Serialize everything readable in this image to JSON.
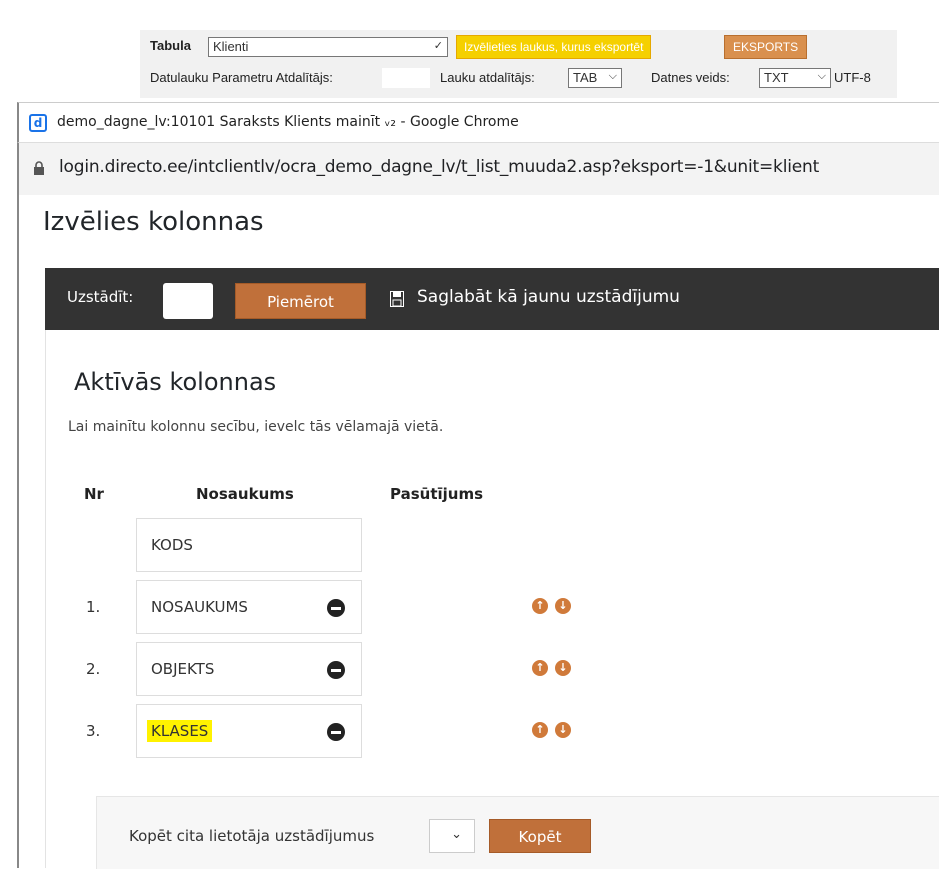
{
  "toolbar": {
    "tabula_label": "Tabula",
    "tabula_value": "Klienti",
    "choose_fields_button": "Izvēlieties laukus, kurus eksportēt",
    "export_button": "EKSPORTS",
    "date_sep_label": "Datulauku Parametru Atdalītājs:",
    "field_sep_label": "Lauku atdalītājs:",
    "field_sep_value": "TAB",
    "file_type_label": "Datnes veids:",
    "file_type_value": "TXT",
    "encoding": "UTF-8"
  },
  "window": {
    "title": "demo_dagne_lv:10101 Saraksts Klients mainīt ᵥ₂ - Google Chrome",
    "url": "login.directo.ee/intclientlv/ocra_demo_dagne_lv/t_list_muuda2.asp?eksport=-1&unit=klient"
  },
  "page": {
    "heading": "Izvēlies kolonnas",
    "set_label": "Uzstādīt:",
    "apply_button": "Piemērot",
    "save_label": "Saglabāt kā jaunu uzstādījumu",
    "active_heading": "Aktīvās kolonnas",
    "hint": "Lai mainītu kolonnu secību, ievelc tās vēlamajā vietā.",
    "columns": {
      "nr": "Nr",
      "name": "Nosaukums",
      "order": "Pasūtījums"
    },
    "rows": [
      {
        "nr": "",
        "name": "KODS"
      },
      {
        "nr": "1.",
        "name": "NOSAUKUMS"
      },
      {
        "nr": "2.",
        "name": "OBJEKTS"
      },
      {
        "nr": "3.",
        "name": "KLASES"
      }
    ],
    "copy_label": "Kopēt cita lietotāja uzstādījumus",
    "copy_button": "Kopēt"
  },
  "colors": {
    "accent": "#c0703a",
    "highlight": "#fff200",
    "dark_bar": "#333333"
  }
}
